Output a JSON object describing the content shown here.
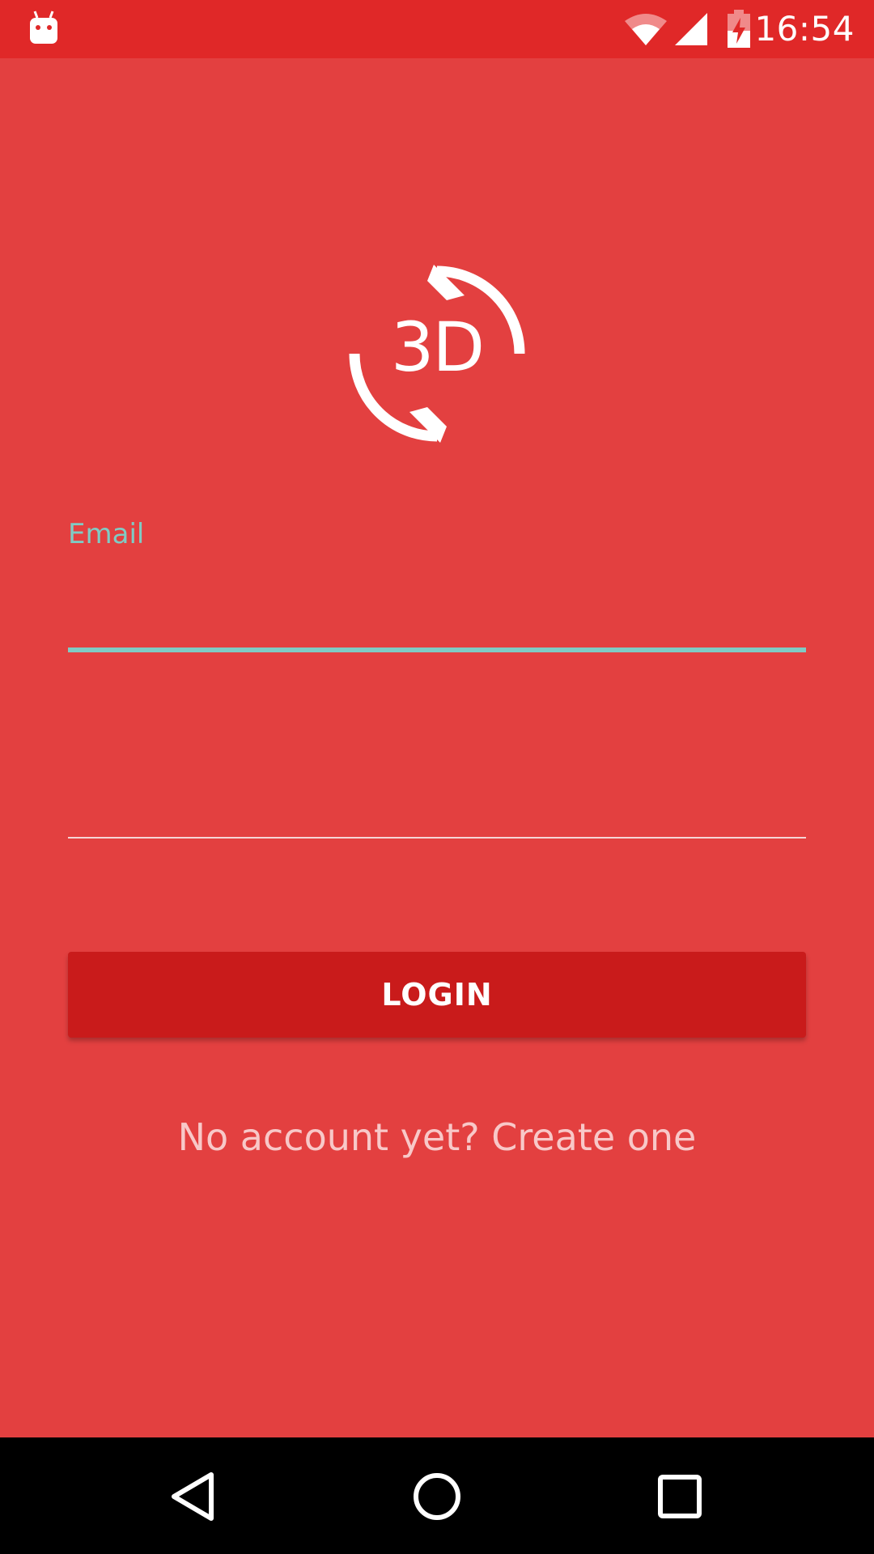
{
  "status_bar": {
    "time": "16:54",
    "icons": [
      "android-notification-icon",
      "wifi-icon",
      "signal-icon",
      "battery-charging-icon"
    ]
  },
  "logo": {
    "text": "3D",
    "icon": "rotate-3d-icon"
  },
  "form": {
    "email_label": "Email",
    "email_value": "",
    "password_value": "",
    "password_placeholder": ""
  },
  "login_button": {
    "label": "LOGIN"
  },
  "signup_link": {
    "text": "No account yet? Create one"
  },
  "nav_bar": {
    "icons": [
      "back-icon",
      "home-icon",
      "recent-apps-icon"
    ]
  },
  "colors": {
    "background": "#E34040",
    "status_bar": "#E02828",
    "accent": "#80CBC4",
    "button": "#C91B1B"
  }
}
